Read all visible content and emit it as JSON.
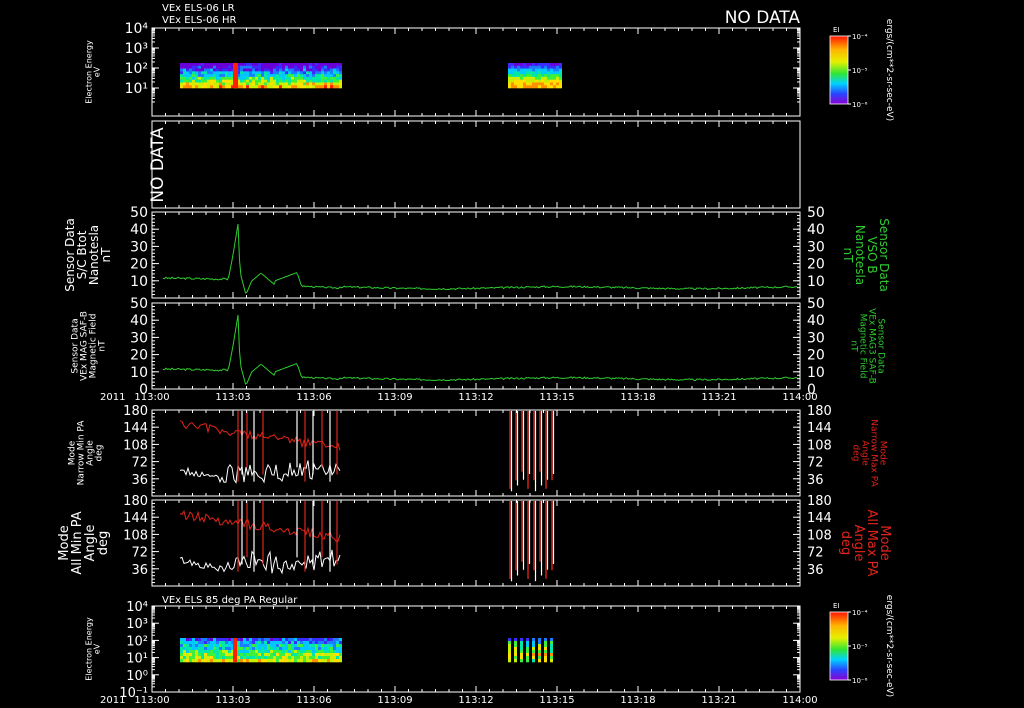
{
  "header": {
    "line1": "VEx ELS-06 LR",
    "line2": "VEx ELS-06 HR",
    "no_data_top": "NO DATA",
    "bottom_title": "VEx ELS 85 deg PA Regular"
  },
  "colors": {
    "background": "#000000",
    "axis": "#ffffff",
    "green": "#2ecc2e",
    "red": "#e0241b",
    "white": "#ffffff"
  },
  "colorbar": {
    "label": "EI",
    "unit": "ergs/(cm**2-sr-sec-eV)",
    "ticks": [
      "10⁻⁴",
      "10⁻⁵",
      "10⁻⁶"
    ]
  },
  "time_axis": {
    "year": "2011",
    "ticks": [
      "113:00",
      "113:03",
      "113:06",
      "113:09",
      "113:12",
      "113:15",
      "113:18",
      "113:21",
      "114:00"
    ]
  },
  "chart_data": [
    {
      "type": "heatmap",
      "panel": "els-lr-hr",
      "ylabel": [
        "Electron Energy",
        "eV"
      ],
      "y_ticks": [
        "10⁴",
        "10³",
        "10²",
        "10¹"
      ],
      "scale": "log",
      "x": [
        "113:00",
        "114:00"
      ]
    },
    {
      "type": "line",
      "panel": "no-data",
      "text": "NO DATA"
    },
    {
      "type": "line",
      "panel": "sc-btot",
      "ylabel": [
        "Sensor Data",
        "S/C Btot",
        "Nanotesla",
        "nT"
      ],
      "ylabel_right": [
        "Sensor Data",
        "VSO B",
        "Nanotesla",
        "nT"
      ],
      "ylim": [
        0,
        50
      ],
      "y_ticks": [
        10,
        20,
        30,
        40,
        50
      ],
      "x": [
        "113:00",
        "114:00"
      ]
    },
    {
      "type": "line",
      "panel": "mag-saf-b",
      "ylabel": [
        "Sensor Data",
        "VEx MAG SAF-B",
        "Magnetic Field",
        "nT"
      ],
      "ylabel_right": [
        "Sensor Data",
        "VEx MAG3 SAF-B",
        "Magnetic Field",
        "nT"
      ],
      "ylim": [
        0,
        50
      ],
      "y_ticks": [
        0,
        10,
        20,
        30,
        40,
        50
      ],
      "x": [
        "113:00",
        "114:00"
      ]
    },
    {
      "type": "line",
      "panel": "narrow-pa",
      "ylabel": [
        "Mode",
        "Narrow Min PA",
        "Angle",
        "deg"
      ],
      "ylabel_right": [
        "Mode",
        "Narrow Max PA",
        "Angle",
        "deg"
      ],
      "ylim": [
        0,
        180
      ],
      "y_ticks": [
        36,
        72,
        108,
        144,
        180
      ],
      "x": [
        "113:00",
        "114:00"
      ]
    },
    {
      "type": "line",
      "panel": "all-pa",
      "ylabel": [
        "Mode",
        "All Min PA",
        "Angle",
        "deg"
      ],
      "ylabel_right": [
        "Mode",
        "All Max PA",
        "Angle",
        "deg"
      ],
      "ylim": [
        0,
        180
      ],
      "y_ticks": [
        36,
        72,
        108,
        144,
        180
      ],
      "x": [
        "113:00",
        "114:00"
      ]
    },
    {
      "type": "heatmap",
      "panel": "els-85deg",
      "ylabel": [
        "Electron Energy",
        "eV"
      ],
      "y_ticks": [
        "10⁴",
        "10³",
        "10²",
        "10¹",
        "10⁰",
        "10⁻¹"
      ],
      "scale": "log",
      "x": [
        "113:00",
        "114:00"
      ]
    }
  ]
}
